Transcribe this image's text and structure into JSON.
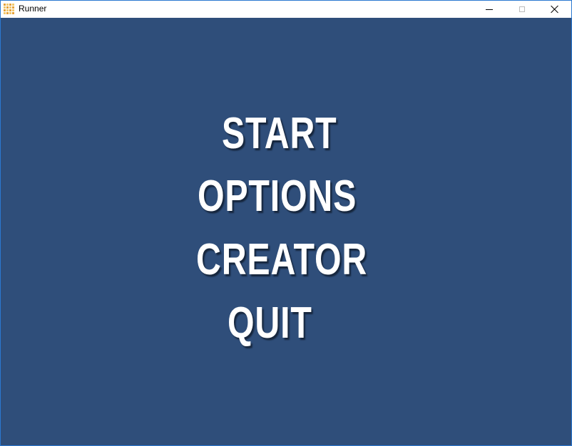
{
  "window": {
    "title": "Runner",
    "icon": "app-grid-icon",
    "controls": {
      "minimize": "minimize-icon",
      "maximize": "maximize-icon",
      "close": "close-icon"
    }
  },
  "colors": {
    "background": "#2f4e7a",
    "menu_text": "#ffffff",
    "menu_shadow": "#16263d",
    "window_border": "#2b79d1"
  },
  "menu": {
    "start": "START",
    "options": "OPTIONS",
    "creator": "CREATOR",
    "quit": "QUIT"
  }
}
